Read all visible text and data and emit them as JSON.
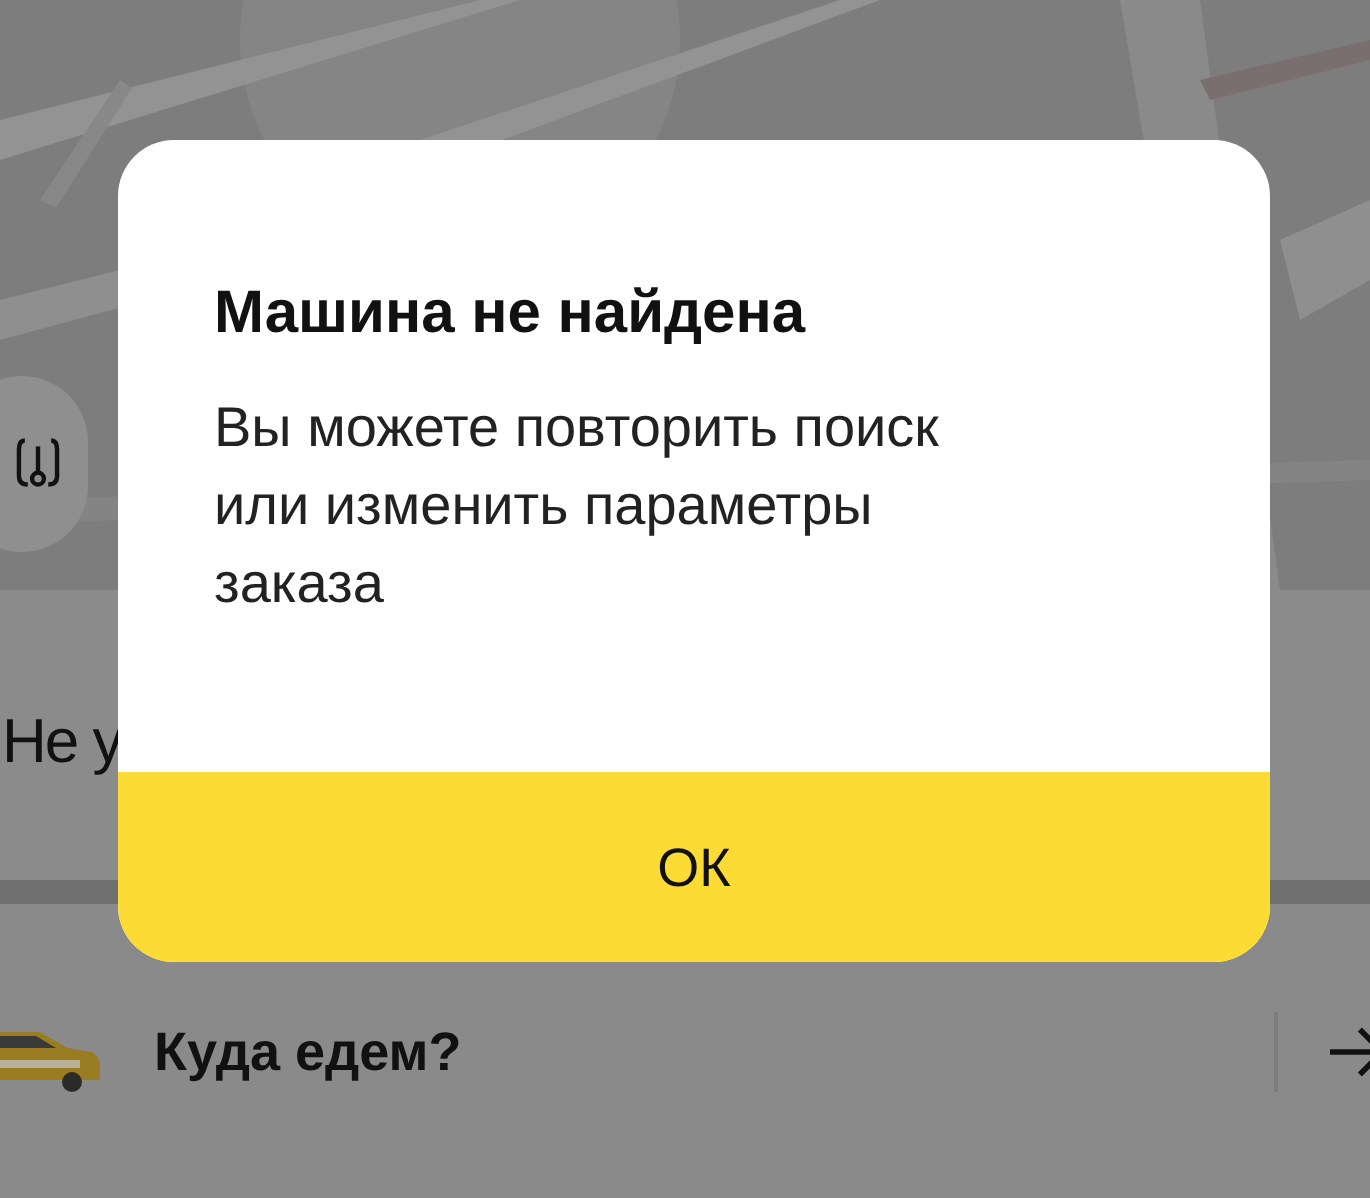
{
  "sheet": {
    "heading": "Не у"
  },
  "destination": {
    "placeholder": "Куда едем?"
  },
  "dialog": {
    "title": "Машина не найдена",
    "message": "Вы можете повторить поиск или изменить параметры заказа",
    "button": "ОК"
  }
}
